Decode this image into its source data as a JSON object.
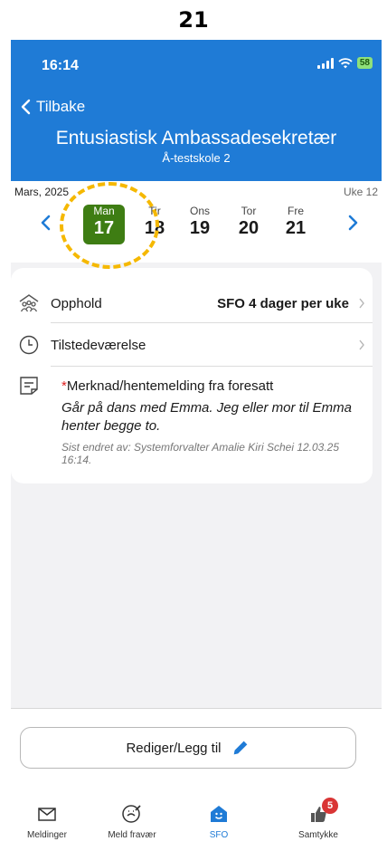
{
  "page_number": "21",
  "status_bar": {
    "time": "16:14",
    "battery": "58"
  },
  "header": {
    "back_label": "Tilbake",
    "title": "Entusiastisk Ambassadesekretær",
    "subtitle": "Å-testskole 2"
  },
  "week": {
    "month": "Mars, 2025",
    "week_label": "Uke 12",
    "days": [
      {
        "name": "Man",
        "num": "17",
        "selected": true
      },
      {
        "name": "Tir",
        "num": "18",
        "selected": false
      },
      {
        "name": "Ons",
        "num": "19",
        "selected": false
      },
      {
        "name": "Tor",
        "num": "20",
        "selected": false
      },
      {
        "name": "Fre",
        "num": "21",
        "selected": false
      }
    ]
  },
  "card": {
    "stay_label": "Opphold",
    "stay_value": "SFO 4 dager per uke",
    "attendance_label": "Tilstedeværelse",
    "note_label_star": "*",
    "note_label": "Merknad/hentemelding fra foresatt",
    "note_text": "Går på dans med Emma. Jeg eller mor til Emma henter begge to.",
    "note_meta": "Sist endret av: Systemforvalter Amalie Kiri Schei 12.03.25 16:14."
  },
  "bottom": {
    "edit_label": "Rediger/Legg til",
    "tabs": [
      {
        "label": "Meldinger",
        "icon": "mail-icon"
      },
      {
        "label": "Meld fravær",
        "icon": "absence-icon"
      },
      {
        "label": "SFO",
        "icon": "sfo-icon",
        "active": true
      },
      {
        "label": "Samtykke",
        "icon": "thumbs-icon",
        "badge": "5"
      }
    ]
  },
  "colors": {
    "header": "#1f7bd6",
    "selected_day": "#3e7d13",
    "highlight": "#f5b800",
    "badge": "#d93535"
  }
}
